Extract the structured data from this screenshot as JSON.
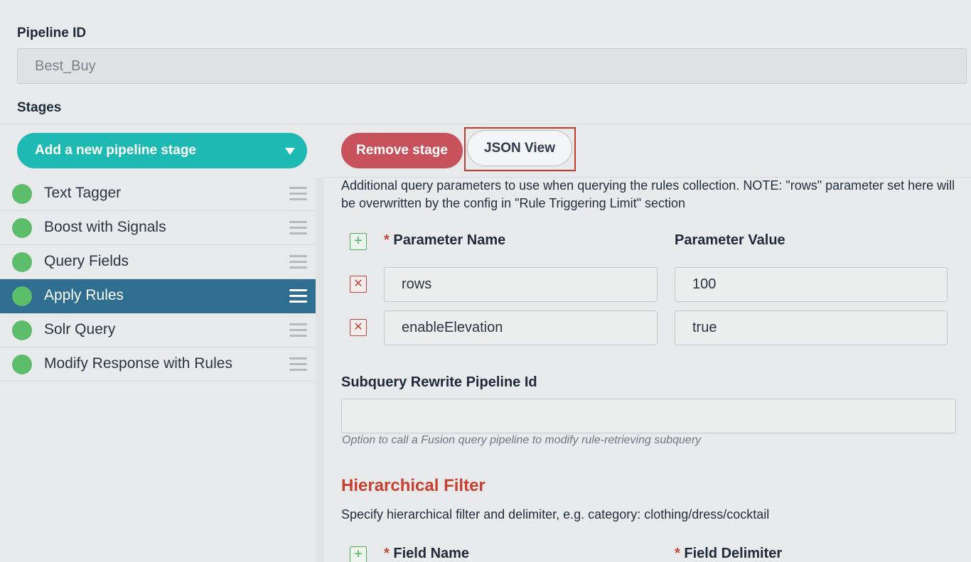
{
  "pipeline": {
    "label": "Pipeline ID",
    "value": "Best_Buy"
  },
  "stages_label": "Stages",
  "toolbar": {
    "add_stage_label": "Add a new pipeline stage",
    "remove_stage_label": "Remove stage",
    "json_view_label": "JSON View"
  },
  "stages": [
    {
      "name": "Text Tagger",
      "active": false
    },
    {
      "name": "Boost with Signals",
      "active": false
    },
    {
      "name": "Query Fields",
      "active": false
    },
    {
      "name": "Apply Rules",
      "active": true
    },
    {
      "name": "Solr Query",
      "active": false
    },
    {
      "name": "Modify Response with Rules",
      "active": false
    }
  ],
  "params": {
    "description": "Additional query parameters to use when querying the rules collection. NOTE: \"rows\" parameter set here will be overwritten by the config in \"Rule Triggering Limit\" section",
    "name_header": "Parameter Name",
    "value_header": "Parameter Value",
    "required_mark": "*",
    "rows": [
      {
        "name": "rows",
        "value": "100"
      },
      {
        "name": "enableElevation",
        "value": "true"
      }
    ]
  },
  "subquery": {
    "label": "Subquery Rewrite Pipeline Id",
    "value": "",
    "help": "Option to call a Fusion query pipeline to modify rule-retrieving subquery"
  },
  "hierarchical": {
    "title": "Hierarchical Filter",
    "description": "Specify hierarchical filter and delimiter, e.g. category: clothing/dress/cocktail",
    "field_name_header": "Field Name",
    "field_delim_header": "Field Delimiter"
  },
  "colors": {
    "accent_teal": "#1fb9b3",
    "remove_red": "#c8525b",
    "active_stage": "#2f6e90",
    "status_green": "#5cbd6a",
    "section_title": "#c8412f"
  }
}
